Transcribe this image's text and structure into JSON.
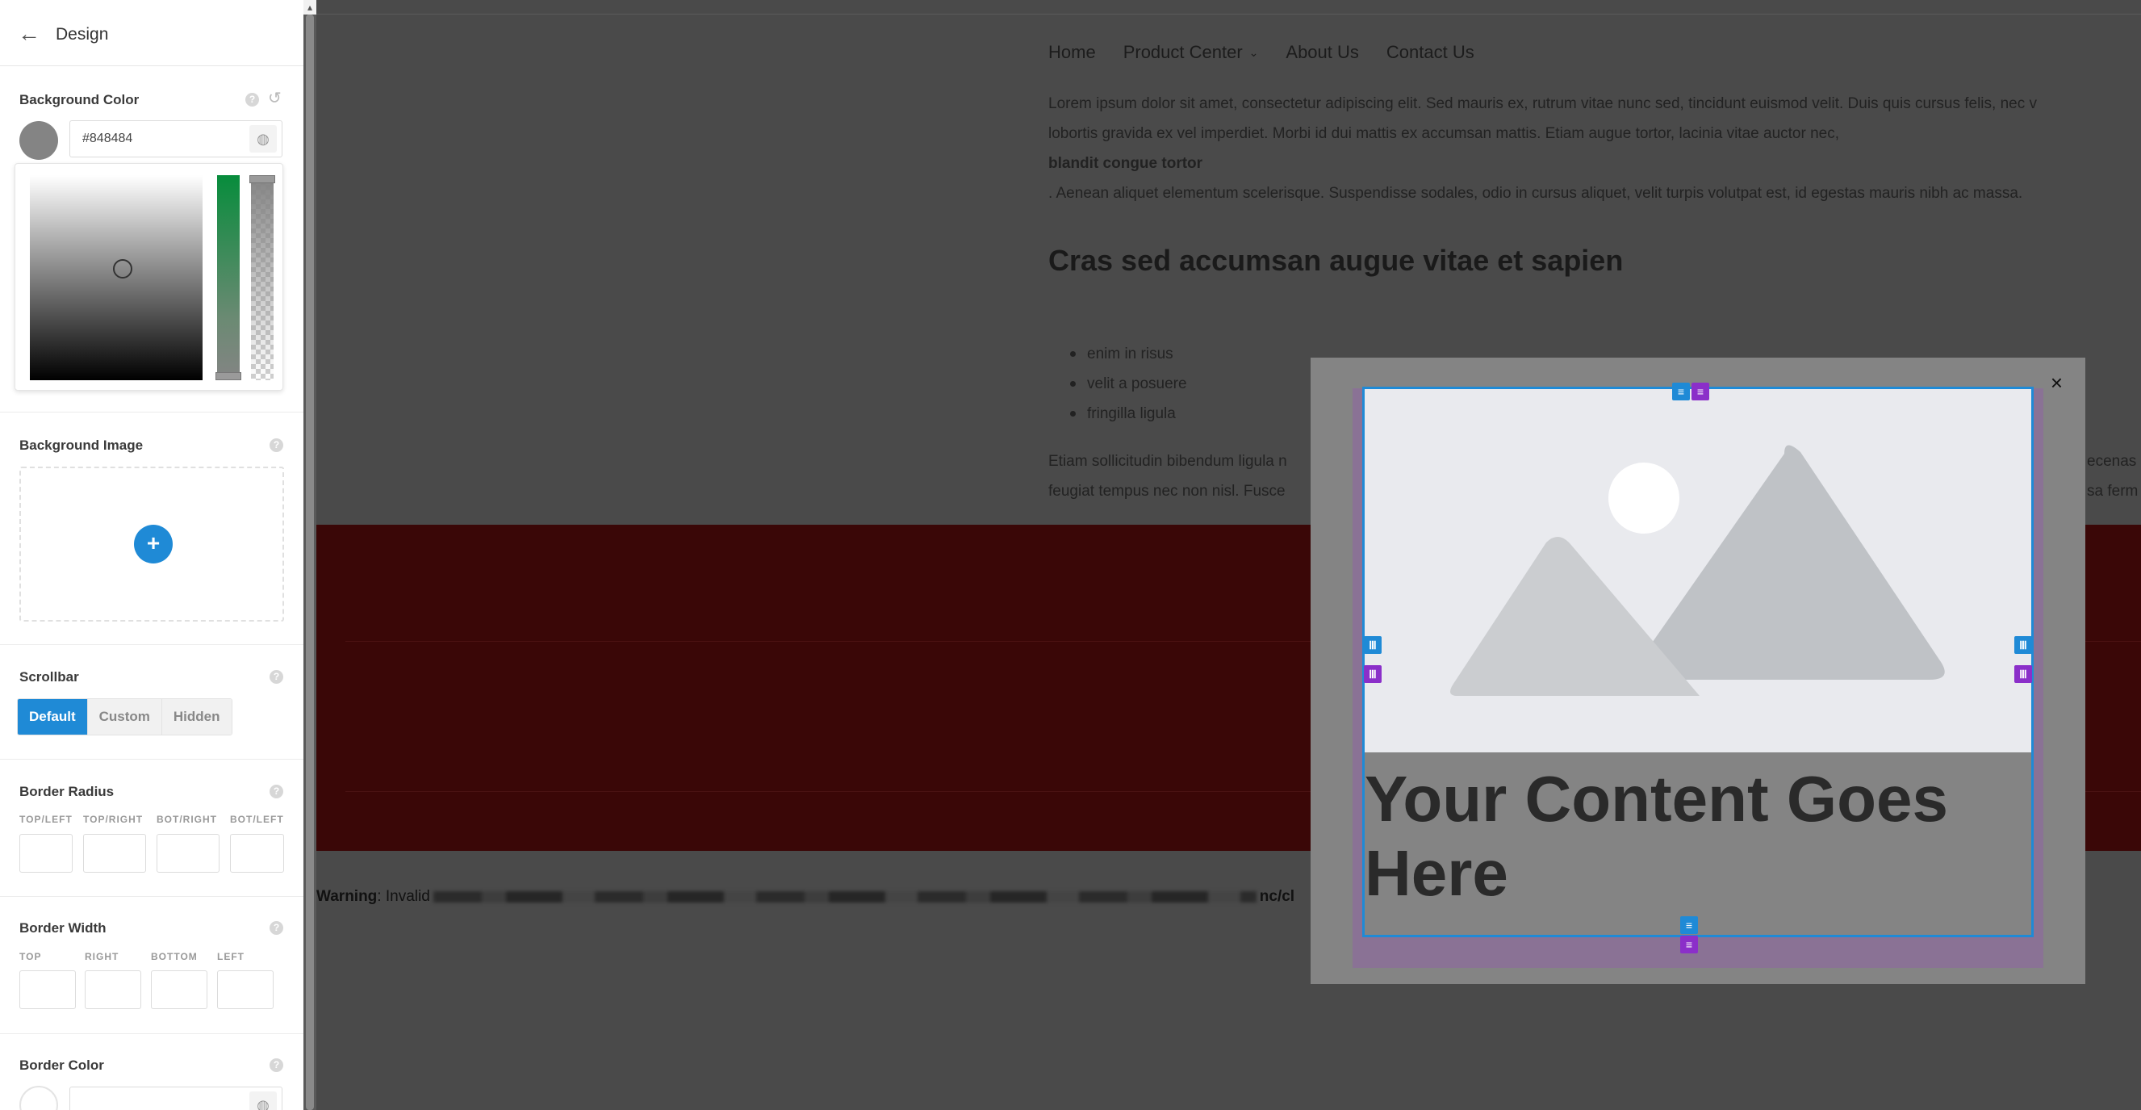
{
  "panel": {
    "title": "Design",
    "background_color": {
      "label": "Background Color",
      "value": "#848484",
      "swatch": "#848484"
    },
    "background_image": {
      "label": "Background Image",
      "add_icon": "+"
    },
    "scrollbar": {
      "label": "Scrollbar",
      "options": [
        "Default",
        "Custom",
        "Hidden"
      ],
      "selected": "Default"
    },
    "border_radius": {
      "label": "Border Radius",
      "fields": [
        "TOP/LEFT",
        "TOP/RIGHT",
        "BOT/RIGHT",
        "BOT/LEFT"
      ]
    },
    "border_width": {
      "label": "Border Width",
      "fields": [
        "TOP",
        "RIGHT",
        "BOTTOM",
        "LEFT"
      ]
    },
    "border_color": {
      "label": "Border Color"
    }
  },
  "page": {
    "nav": [
      "Home",
      "Product Center",
      "About Us",
      "Contact Us"
    ],
    "para1_line1": "Lorem ipsum dolor sit amet, consectetur adipiscing elit. Sed mauris ex, rutrum vitae nunc sed, tincidunt euismod velit. Duis quis cursus felis, nec v",
    "para1_line2": "lobortis gravida ex vel imperdiet. Morbi id dui mattis ex accumsan mattis. Etiam augue tortor, lacinia vitae auctor nec,",
    "para1_bold": "blandit congue tortor",
    "para1_line4": ". Aenean aliquet elementum scelerisque. Suspendisse sodales, odio in cursus aliquet, velit turpis volutpat est, id egestas mauris nibh ac massa.",
    "heading": "Cras sed accumsan augue vitae et sapien",
    "bullets": [
      "enim in risus",
      "velit a posuere",
      "fringilla ligula"
    ],
    "para2_line1_left": "Etiam sollicitudin bibendum ligula n",
    "para2_line1_right": "ecenas",
    "para2_line2_left": "feugiat tempus nec non nisl. Fusce",
    "para2_line2_right": "sa ferm",
    "warning_label": "Warning",
    "warning_text": ": Invalid",
    "warning_tail": "nc/cl"
  },
  "modal": {
    "close": "×",
    "content_heading": "Your Content Goes Here"
  },
  "colors": {
    "accent": "#1f8ad6",
    "purple": "#8b2fc9",
    "red_band": "#3a0707"
  }
}
